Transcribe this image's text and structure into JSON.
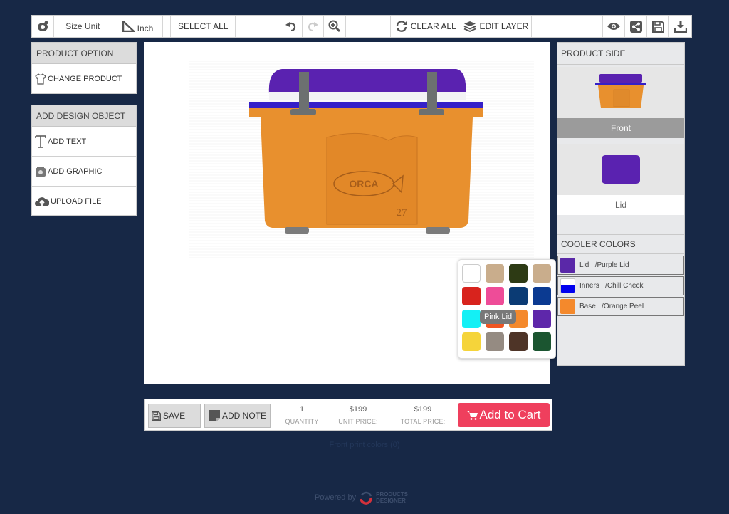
{
  "toolbar": {
    "logo_icon": "designer-logo-icon",
    "size_unit_label": "Size Unit",
    "unit_value": "Inch",
    "select_all": "SELECT ALL",
    "clear_all": "CLEAR ALL",
    "edit_layer": "EDIT LAYER",
    "icons": [
      "undo-icon",
      "redo-icon",
      "zoom-in-icon",
      "refresh-icon",
      "layers-icon",
      "eye-icon",
      "share-icon",
      "save-icon",
      "download-icon"
    ]
  },
  "product_option": {
    "title": "PRODUCT OPTION",
    "items": [
      {
        "label": "CHANGE PRODUCT",
        "icon": "tshirt-icon"
      }
    ]
  },
  "design_object": {
    "title": "ADD DESIGN OBJECT",
    "items": [
      {
        "label": "ADD TEXT",
        "icon": "text-icon"
      },
      {
        "label": "ADD GRAPHIC",
        "icon": "graphic-icon"
      },
      {
        "label": "UPLOAD FILE",
        "icon": "cloud-upload-icon"
      }
    ]
  },
  "product_side": {
    "title": "PRODUCT SIDE",
    "sides": [
      {
        "label": "Front",
        "active": true
      },
      {
        "label": "Lid",
        "active": false
      }
    ]
  },
  "cooler_colors": {
    "title": "COOLER COLORS",
    "rows": [
      {
        "part": "Lid",
        "color_name": "/Purple Lid",
        "color": "#5a28a8"
      },
      {
        "part": "Inners",
        "color_name": "/Chill Check",
        "color": "#0000ee"
      },
      {
        "part": "Base",
        "color_name": "/Orange Peel",
        "color": "#f4892c"
      }
    ]
  },
  "color_popup": {
    "tooltip": "Pink Lid",
    "swatches": [
      "#ffffff",
      "#c9ad8c",
      "#2d3a14",
      "#c9ad8c",
      "#d8231d",
      "#ee4c98",
      "#0b3b74",
      "#0b3a91",
      "#13f0f5",
      "#f05522",
      "#f4892c",
      "#5e27aa",
      "#f5d43a",
      "#958b82",
      "#4e3427",
      "#1b5530"
    ]
  },
  "bottom_bar": {
    "save": "SAVE",
    "add_note": "ADD NOTE",
    "quantity_value": "1",
    "quantity_label": "QUANTITY",
    "unit_price_value": "$199",
    "unit_price_label": "UNIT PRICE:",
    "total_price_value": "$199",
    "total_price_label": "TOTAL PRICE:",
    "add_to_cart": "Add to Cart"
  },
  "footer": {
    "print_colors": "Front print colors  (0)",
    "powered_by": "Powered by",
    "brand_line1": "PRODUCTS",
    "brand_line2": "DESIGNER"
  },
  "colors": {
    "background": "#172846",
    "cart_button": "#ef3f5d",
    "cooler_body": "#e8902e",
    "cooler_lid": "#5a22b0"
  }
}
